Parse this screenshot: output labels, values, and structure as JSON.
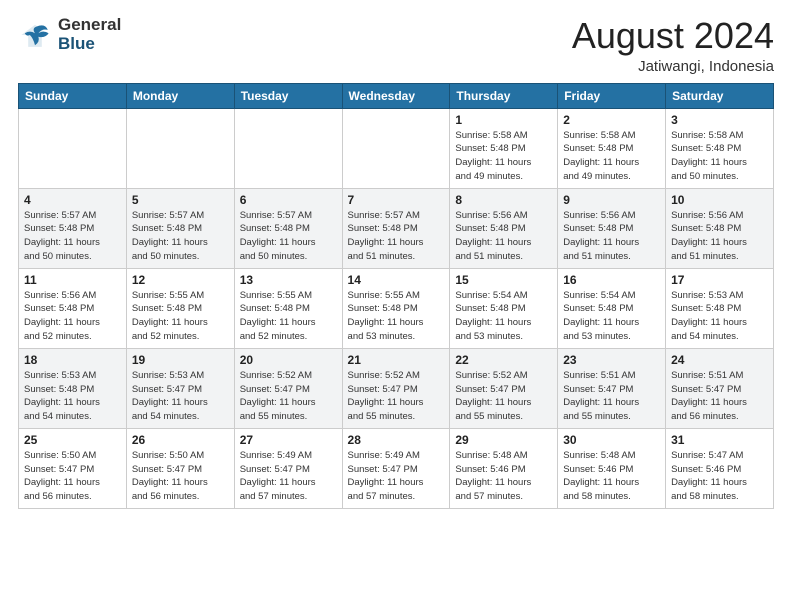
{
  "header": {
    "logo_general": "General",
    "logo_blue": "Blue",
    "month_year": "August 2024",
    "location": "Jatiwangi, Indonesia"
  },
  "weekdays": [
    "Sunday",
    "Monday",
    "Tuesday",
    "Wednesday",
    "Thursday",
    "Friday",
    "Saturday"
  ],
  "weeks": [
    [
      {
        "day": "",
        "info": ""
      },
      {
        "day": "",
        "info": ""
      },
      {
        "day": "",
        "info": ""
      },
      {
        "day": "",
        "info": ""
      },
      {
        "day": "1",
        "info": "Sunrise: 5:58 AM\nSunset: 5:48 PM\nDaylight: 11 hours\nand 49 minutes."
      },
      {
        "day": "2",
        "info": "Sunrise: 5:58 AM\nSunset: 5:48 PM\nDaylight: 11 hours\nand 49 minutes."
      },
      {
        "day": "3",
        "info": "Sunrise: 5:58 AM\nSunset: 5:48 PM\nDaylight: 11 hours\nand 50 minutes."
      }
    ],
    [
      {
        "day": "4",
        "info": "Sunrise: 5:57 AM\nSunset: 5:48 PM\nDaylight: 11 hours\nand 50 minutes."
      },
      {
        "day": "5",
        "info": "Sunrise: 5:57 AM\nSunset: 5:48 PM\nDaylight: 11 hours\nand 50 minutes."
      },
      {
        "day": "6",
        "info": "Sunrise: 5:57 AM\nSunset: 5:48 PM\nDaylight: 11 hours\nand 50 minutes."
      },
      {
        "day": "7",
        "info": "Sunrise: 5:57 AM\nSunset: 5:48 PM\nDaylight: 11 hours\nand 51 minutes."
      },
      {
        "day": "8",
        "info": "Sunrise: 5:56 AM\nSunset: 5:48 PM\nDaylight: 11 hours\nand 51 minutes."
      },
      {
        "day": "9",
        "info": "Sunrise: 5:56 AM\nSunset: 5:48 PM\nDaylight: 11 hours\nand 51 minutes."
      },
      {
        "day": "10",
        "info": "Sunrise: 5:56 AM\nSunset: 5:48 PM\nDaylight: 11 hours\nand 51 minutes."
      }
    ],
    [
      {
        "day": "11",
        "info": "Sunrise: 5:56 AM\nSunset: 5:48 PM\nDaylight: 11 hours\nand 52 minutes."
      },
      {
        "day": "12",
        "info": "Sunrise: 5:55 AM\nSunset: 5:48 PM\nDaylight: 11 hours\nand 52 minutes."
      },
      {
        "day": "13",
        "info": "Sunrise: 5:55 AM\nSunset: 5:48 PM\nDaylight: 11 hours\nand 52 minutes."
      },
      {
        "day": "14",
        "info": "Sunrise: 5:55 AM\nSunset: 5:48 PM\nDaylight: 11 hours\nand 53 minutes."
      },
      {
        "day": "15",
        "info": "Sunrise: 5:54 AM\nSunset: 5:48 PM\nDaylight: 11 hours\nand 53 minutes."
      },
      {
        "day": "16",
        "info": "Sunrise: 5:54 AM\nSunset: 5:48 PM\nDaylight: 11 hours\nand 53 minutes."
      },
      {
        "day": "17",
        "info": "Sunrise: 5:53 AM\nSunset: 5:48 PM\nDaylight: 11 hours\nand 54 minutes."
      }
    ],
    [
      {
        "day": "18",
        "info": "Sunrise: 5:53 AM\nSunset: 5:48 PM\nDaylight: 11 hours\nand 54 minutes."
      },
      {
        "day": "19",
        "info": "Sunrise: 5:53 AM\nSunset: 5:47 PM\nDaylight: 11 hours\nand 54 minutes."
      },
      {
        "day": "20",
        "info": "Sunrise: 5:52 AM\nSunset: 5:47 PM\nDaylight: 11 hours\nand 55 minutes."
      },
      {
        "day": "21",
        "info": "Sunrise: 5:52 AM\nSunset: 5:47 PM\nDaylight: 11 hours\nand 55 minutes."
      },
      {
        "day": "22",
        "info": "Sunrise: 5:52 AM\nSunset: 5:47 PM\nDaylight: 11 hours\nand 55 minutes."
      },
      {
        "day": "23",
        "info": "Sunrise: 5:51 AM\nSunset: 5:47 PM\nDaylight: 11 hours\nand 55 minutes."
      },
      {
        "day": "24",
        "info": "Sunrise: 5:51 AM\nSunset: 5:47 PM\nDaylight: 11 hours\nand 56 minutes."
      }
    ],
    [
      {
        "day": "25",
        "info": "Sunrise: 5:50 AM\nSunset: 5:47 PM\nDaylight: 11 hours\nand 56 minutes."
      },
      {
        "day": "26",
        "info": "Sunrise: 5:50 AM\nSunset: 5:47 PM\nDaylight: 11 hours\nand 56 minutes."
      },
      {
        "day": "27",
        "info": "Sunrise: 5:49 AM\nSunset: 5:47 PM\nDaylight: 11 hours\nand 57 minutes."
      },
      {
        "day": "28",
        "info": "Sunrise: 5:49 AM\nSunset: 5:47 PM\nDaylight: 11 hours\nand 57 minutes."
      },
      {
        "day": "29",
        "info": "Sunrise: 5:48 AM\nSunset: 5:46 PM\nDaylight: 11 hours\nand 57 minutes."
      },
      {
        "day": "30",
        "info": "Sunrise: 5:48 AM\nSunset: 5:46 PM\nDaylight: 11 hours\nand 58 minutes."
      },
      {
        "day": "31",
        "info": "Sunrise: 5:47 AM\nSunset: 5:46 PM\nDaylight: 11 hours\nand 58 minutes."
      }
    ]
  ]
}
